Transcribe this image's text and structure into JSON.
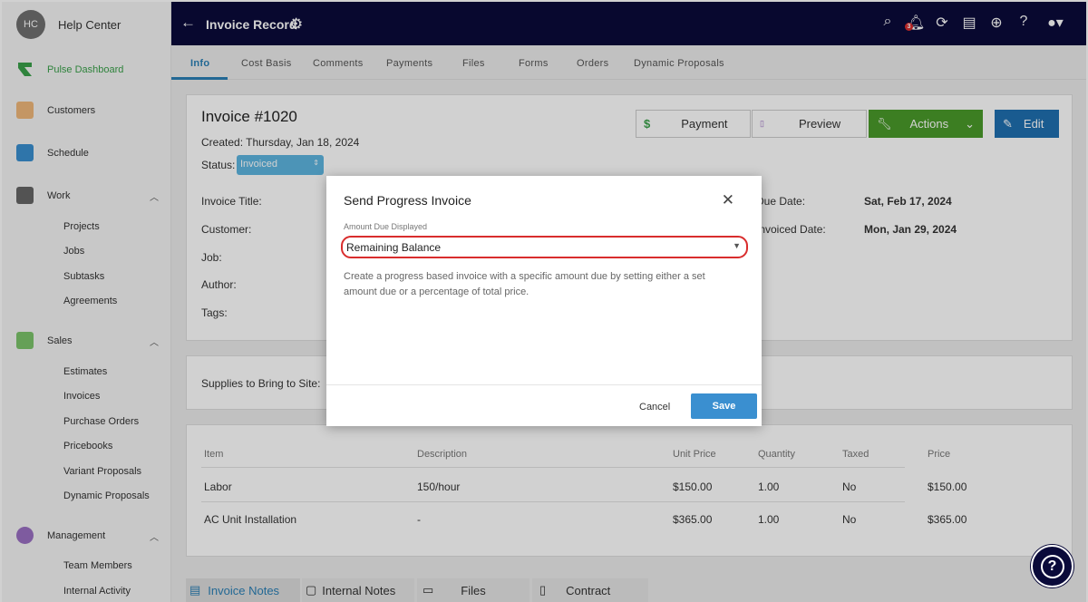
{
  "sidebar": {
    "avatar": "HC",
    "title": "Help Center",
    "items": [
      {
        "label": "Pulse Dashboard"
      },
      {
        "label": "Customers"
      },
      {
        "label": "Schedule"
      },
      {
        "label": "Work"
      },
      {
        "label": "Sales"
      },
      {
        "label": "Management"
      }
    ],
    "work_sub": [
      "Projects",
      "Jobs",
      "Subtasks",
      "Agreements"
    ],
    "sales_sub": [
      "Estimates",
      "Invoices",
      "Purchase Orders",
      "Pricebooks",
      "Variant Proposals",
      "Dynamic Proposals"
    ],
    "mgmt_sub": [
      "Team Members",
      "Internal Activity"
    ]
  },
  "header": {
    "title": "Invoice Record",
    "notification_count": "3"
  },
  "tabs": [
    "Info",
    "Cost Basis",
    "Comments",
    "Payments",
    "Files",
    "Forms",
    "Orders",
    "Dynamic Proposals"
  ],
  "invoice": {
    "number": "Invoice #1020",
    "created": "Created: Thursday, Jan 18, 2024",
    "status_label": "Status:",
    "status_value": "Invoiced",
    "fields": [
      "Invoice Title:",
      "Customer:",
      "Job:",
      "Author:",
      "Tags:"
    ],
    "due_label": "Due Date:",
    "due_value": "Sat, Feb 17, 2024",
    "invoiced_label": "Invoiced Date:",
    "invoiced_value": "Mon, Jan 29, 2024",
    "supplies_label": "Supplies to Bring to Site:"
  },
  "buttons": {
    "payment": "Payment",
    "preview": "Preview",
    "actions": "Actions",
    "edit": "Edit"
  },
  "table": {
    "headers": [
      "Item",
      "Description",
      "Unit Price",
      "Quantity",
      "Taxed",
      "Price"
    ],
    "rows": [
      [
        "Labor",
        "150/hour",
        "$150.00",
        "1.00",
        "No",
        "$150.00"
      ],
      [
        "AC Unit Installation",
        "-",
        "$365.00",
        "1.00",
        "No",
        "$365.00"
      ]
    ]
  },
  "bottom_tabs": [
    "Invoice Notes",
    "Internal Notes",
    "Files",
    "Contract"
  ],
  "modal": {
    "title": "Send Progress Invoice",
    "amount_label": "Amount Due Displayed",
    "amount_value": "Remaining Balance",
    "description": "Create a progress based invoice with a specific amount due by setting either a set amount due or a percentage of total price.",
    "cancel": "Cancel",
    "save": "Save"
  },
  "colors": {
    "nav": "#0a0a3a",
    "accent": "#2a7fb5",
    "actions_green": "#4a9a2a",
    "highlight_red": "#d92d2d"
  }
}
